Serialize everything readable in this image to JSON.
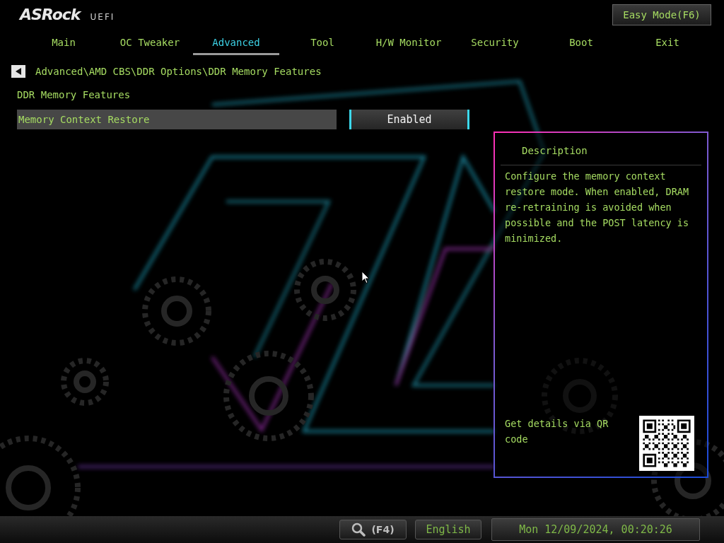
{
  "header": {
    "logo": "ASRock",
    "logo_suffix": "UEFI",
    "easy_mode_button": "Easy Mode(F6)"
  },
  "tabs": [
    {
      "label": "Main",
      "selected": false
    },
    {
      "label": "OC Tweaker",
      "selected": false
    },
    {
      "label": "Advanced",
      "selected": true
    },
    {
      "label": "Tool",
      "selected": false
    },
    {
      "label": "H/W Monitor",
      "selected": false
    },
    {
      "label": "Security",
      "selected": false
    },
    {
      "label": "Boot",
      "selected": false
    },
    {
      "label": "Exit",
      "selected": false
    }
  ],
  "breadcrumb": {
    "path": "Advanced\\AMD CBS\\DDR Options\\DDR Memory Features"
  },
  "page_title": "DDR Memory Features",
  "settings": [
    {
      "label": "Memory Context Restore",
      "value": "Enabled",
      "selected": true
    }
  ],
  "description": {
    "title": "Description",
    "text": "Configure the memory context restore mode. When enabled, DRAM re-retraining is avoided when possible and the POST latency is minimized.",
    "qr_hint": "Get details via QR code"
  },
  "footer": {
    "search_key": "(F4)",
    "language": "English",
    "datetime": "Mon 12/09/2024, 00:20:26"
  }
}
